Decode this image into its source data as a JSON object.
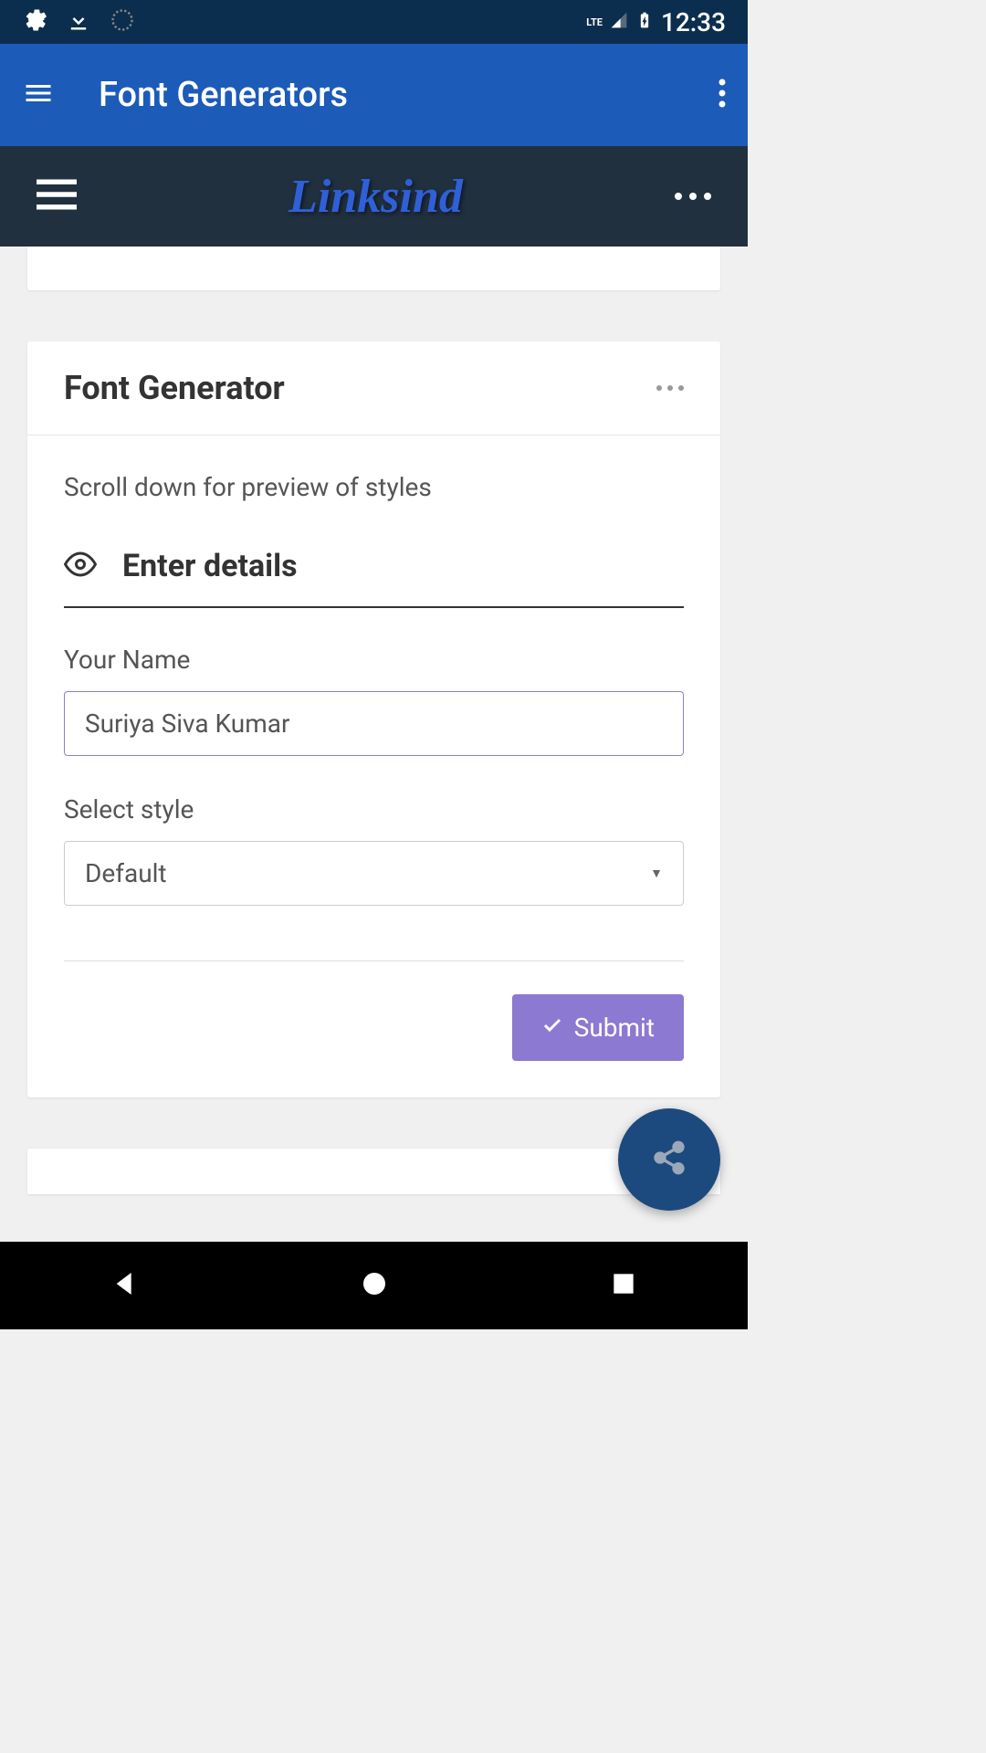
{
  "statusBar": {
    "lte": "LTE",
    "time": "12:33"
  },
  "appBar": {
    "title": "Font Generators"
  },
  "webBar": {
    "brand": "Linksind"
  },
  "card": {
    "title": "Font Generator",
    "scrollHint": "Scroll down for preview of styles",
    "sectionTitle": "Enter details",
    "nameLabel": "Your Name",
    "nameValue": "Suriya Siva Kumar",
    "styleLabel": "Select style",
    "styleSelected": "Default",
    "submitLabel": "Submit"
  }
}
